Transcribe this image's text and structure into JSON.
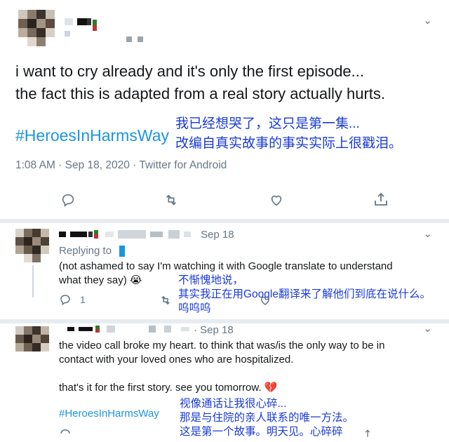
{
  "main_tweet": {
    "text_line1": "i want to cry already and it's only the first episode...",
    "text_line2": "the fact this is adapted from a real story actually hurts.",
    "hashtag": "#HeroesInHarmsWay",
    "translation_line1": "我已经想哭了，这只是第一集...",
    "translation_line2": "改编自真实故事的事实实际上很戳泪。",
    "timestamp": "1:08 AM · Sep 18, 2020 · Twitter for Android",
    "icons": [
      "reply-icon",
      "retweet-icon",
      "like-icon",
      "share-icon"
    ]
  },
  "reply1": {
    "date": "Sep 18",
    "replying_to": "Replying to",
    "text_line1": "(not ashamed to say I'm watching it with Google translate to understand",
    "text_line2": "what they say) 😭",
    "reply_count": "1",
    "translation_line1": "不惭愧地说，",
    "translation_line2": "其实我正在用Google翻译来了解他们到底在说什么。",
    "translation_line3": "呜呜呜"
  },
  "reply2": {
    "date": "· Sep 18",
    "text_line1": "the video call broke my heart. to think that was/is the only way to be in",
    "text_line2": "contact with your loved ones who are hospitalized.",
    "text_line3": "that's it for the first story. see you tomorrow. 💔",
    "hashtag": "#HeroesInHarmsWay",
    "translation_line1": "视像通话让我很心碎...",
    "translation_line2": "那是与住院的亲人联系的唯一方法。",
    "translation_line3": "这是第一个故事。明天见。心碎碎"
  },
  "colors": {
    "link": "#1b95e0",
    "translation": "#1a3bd6",
    "muted": "#657786",
    "divider": "#e6ecf0"
  }
}
